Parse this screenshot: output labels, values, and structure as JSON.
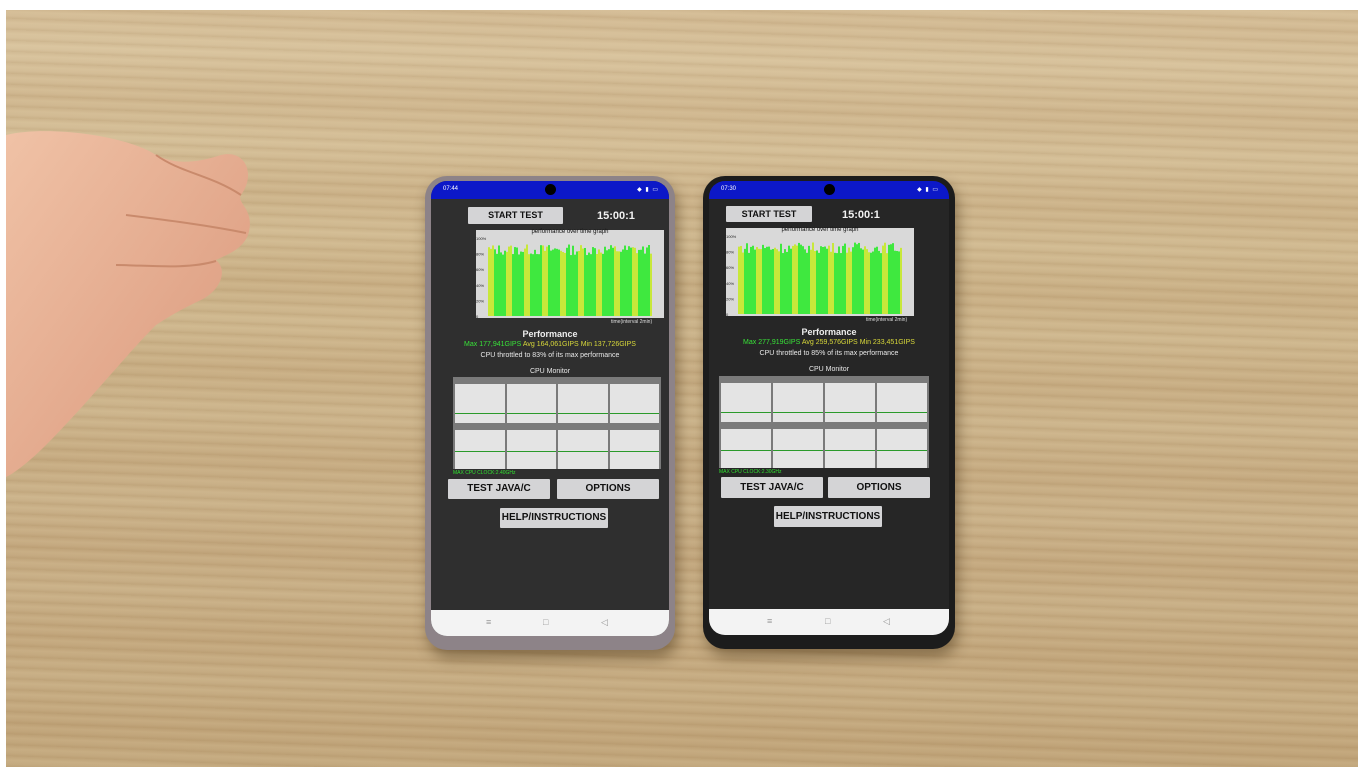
{
  "photo_description_colors": {
    "wood": "#cfb88f",
    "screen_blue": "#0c18c8",
    "graph_green": "#3fe83f",
    "graph_yellow": "#d8e03a"
  },
  "phones": [
    {
      "status_time": "07:44",
      "start_button": "START TEST",
      "timer": "15:00:1",
      "graph_title": "performance over time graph",
      "graph_axis": "time(interval 2min)",
      "y_ticks": [
        "100%",
        "80%",
        "60%",
        "40%",
        "20%",
        "0"
      ],
      "perf_title": "Performance",
      "max": "Max 177,941GIPS",
      "avg": "Avg 164,061GIPS",
      "min": "Min 137,726GIPS",
      "throttle": "CPU throttled to 83% of its max performance",
      "cpu_title": "CPU Monitor",
      "max_clock": "MAX CPU CLOCK:2.40GHz",
      "test_button": "TEST JAVA/C",
      "options_button": "OPTIONS",
      "help_button": "HELP/INSTRUCTIONS"
    },
    {
      "status_time": "07:30",
      "start_button": "START TEST",
      "timer": "15:00:1",
      "graph_title": "performance over time graph",
      "graph_axis": "time(interval 2min)",
      "y_ticks": [
        "100%",
        "80%",
        "60%",
        "40%",
        "20%",
        "0"
      ],
      "perf_title": "Performance",
      "max": "Max 277,919GIPS",
      "avg": "Avg 259,576GIPS",
      "min": "Min 233,451GIPS",
      "throttle": "CPU throttled to 85% of its max performance",
      "cpu_title": "CPU Monitor",
      "max_clock": "MAX CPU CLOCK:2.30GHz",
      "test_button": "TEST JAVA/C",
      "options_button": "OPTIONS",
      "help_button": "HELP/INSTRUCTIONS"
    }
  ]
}
